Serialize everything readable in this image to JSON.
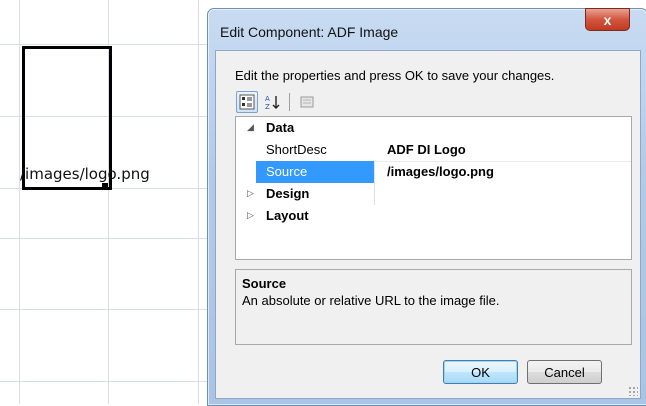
{
  "canvas": {
    "image_caption": "/images/logo.png"
  },
  "dialog": {
    "title": "Edit Component: ADF Image",
    "close_glyph": "x",
    "instructions": "Edit the properties and press OK to save your changes.",
    "toolbar": {
      "categorized_icon": "categorized-view-icon",
      "alphabetical_icon": "sort-alphabetical-icon",
      "property_pages_icon": "property-pages-icon"
    },
    "categories": [
      {
        "label": "Data",
        "expanded": true,
        "properties": [
          {
            "name": "ShortDesc",
            "value": "ADF DI Logo",
            "selected": false
          },
          {
            "name": "Source",
            "value": "/images/logo.png",
            "selected": true
          }
        ]
      },
      {
        "label": "Design",
        "expanded": false
      },
      {
        "label": "Layout",
        "expanded": false
      }
    ],
    "description": {
      "title": "Source",
      "text": "An absolute or relative URL to the image file."
    },
    "buttons": {
      "ok": "OK",
      "cancel": "Cancel"
    },
    "colors": {
      "selection": "#3399ff",
      "close_button": "#c03a22"
    }
  }
}
